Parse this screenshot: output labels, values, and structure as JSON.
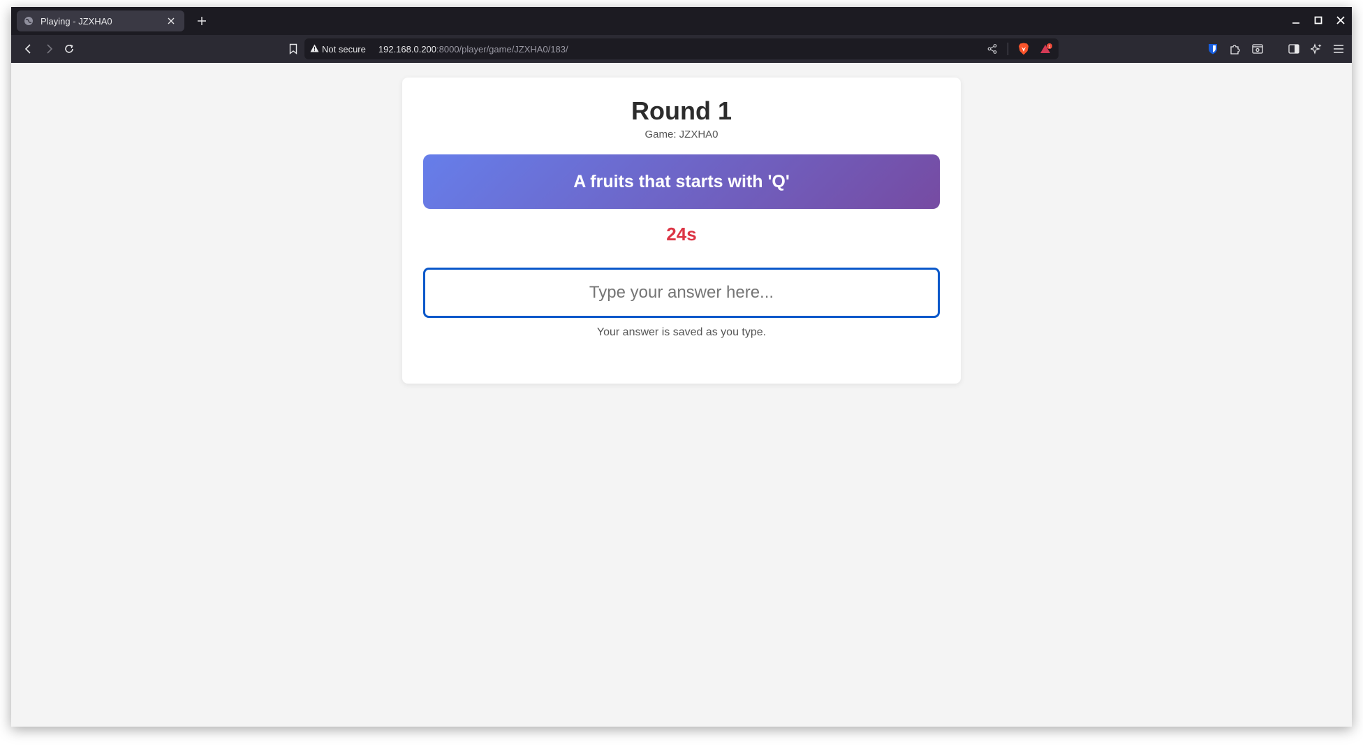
{
  "browser": {
    "tab_title": "Playing - JZXHA0",
    "security_label": "Not secure",
    "url_host": "192.168.0.200",
    "url_rest": ":8000/player/game/JZXHA0/183/",
    "icons": {
      "favicon": "globe-icon",
      "tab_close": "close-icon",
      "new_tab": "plus-icon",
      "back": "back-arrow-icon",
      "forward": "forward-arrow-icon",
      "reload": "reload-icon",
      "bookmark": "bookmark-icon",
      "warning": "warning-icon",
      "share": "share-icon",
      "brave_shields": "brave-lion-icon",
      "rewards": "brave-rewards-icon",
      "bitwarden": "shield-extension-icon",
      "extensions": "puzzle-icon",
      "tab_search": "tab-search-icon",
      "sidebar": "sidebar-icon",
      "leo": "sparkle-icon",
      "menu": "hamburger-menu-icon"
    }
  },
  "game": {
    "round_title": "Round 1",
    "game_code": "Game: JZXHA0",
    "prompt": "A fruits that starts with 'Q'",
    "timer": "24s",
    "answer": {
      "value": "",
      "placeholder": "Type your answer here..."
    },
    "hint": "Your answer is saved as you type."
  },
  "colors": {
    "prompt_gradient_start": "#667eea",
    "prompt_gradient_end": "#764ba2",
    "timer": "#dc3545",
    "input_border": "#0a58ca",
    "page_bg": "#f4f4f4"
  }
}
